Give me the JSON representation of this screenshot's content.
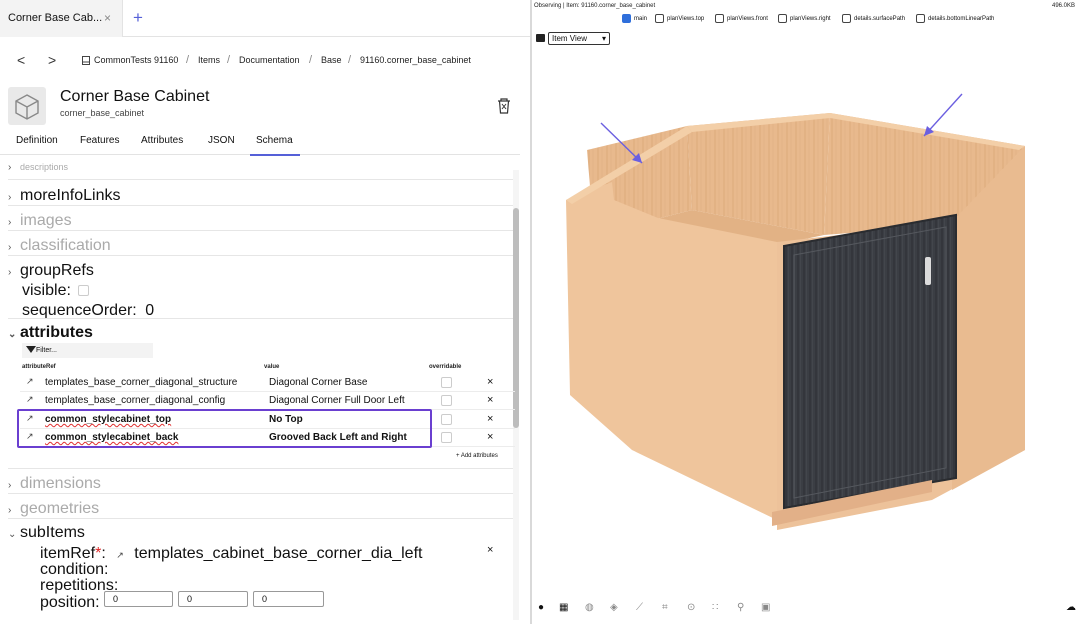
{
  "tab": {
    "title": "Corner Base Cab...",
    "close": "×",
    "add": "+"
  },
  "nav": {
    "back": "<",
    "forward": ">"
  },
  "breadcrumb": [
    "CommonTests 91160",
    "Items",
    "Documentation",
    "Base",
    "91160.corner_base_cabinet"
  ],
  "breadcrumb_sep": "/",
  "item": {
    "title": "Corner Base Cabinet",
    "id": "corner_base_cabinet"
  },
  "detail_tabs": [
    "Definition",
    "Features",
    "Attributes",
    "JSON",
    "Schema"
  ],
  "active_tab": "Schema",
  "tree": {
    "descriptions": "descriptions",
    "moreInfoLinks": "moreInfoLinks",
    "images": "images",
    "classification": "classification",
    "groupRefs": "groupRefs",
    "visible": "visible:",
    "sequenceOrder_label": "sequenceOrder:",
    "sequenceOrder_value": "0",
    "attributes": "attributes",
    "dimensions": "dimensions",
    "geometries": "geometries",
    "subItems": "subItems"
  },
  "filter_placeholder": "Filter...",
  "attr_columns": {
    "ref": "attributeRef",
    "value": "value",
    "overridable": "overridable"
  },
  "attributes": [
    {
      "ref": "templates_base_corner_diagonal_structure",
      "value": "Diagonal Corner Base",
      "bold": false
    },
    {
      "ref": "templates_base_corner_diagonal_config",
      "value": "Diagonal Corner Full Door Left",
      "bold": false
    },
    {
      "ref": "common_stylecabinet_top",
      "value": "No Top",
      "bold": true
    },
    {
      "ref": "common_stylecabinet_back",
      "value": "Grooved Back Left and Right",
      "bold": true
    }
  ],
  "remove_symbol": "×",
  "add_attributes": "+ Add attributes",
  "subitem": {
    "itemRef_label": "itemRef",
    "required_mark": "*",
    "itemRef_value": "templates_cabinet_base_corner_dia_left",
    "condition_label": "condition:",
    "repetitions_label": "repetitions:",
    "position_label": "position:",
    "position_values": [
      "0",
      "0",
      "0"
    ]
  },
  "viewer": {
    "status": "Observing | Item: 91160.corner_base_cabinet",
    "size": "496.0KB",
    "layers": [
      {
        "label": "main",
        "checked": true
      },
      {
        "label": "planViews.top",
        "checked": false
      },
      {
        "label": "planViews.front",
        "checked": false
      },
      {
        "label": "planViews.right",
        "checked": false
      },
      {
        "label": "details.surfacePath",
        "checked": false
      },
      {
        "label": "details.bottomLinearPath",
        "checked": false
      }
    ],
    "view_select": "Item View"
  },
  "colors": {
    "accent": "#5560d8",
    "highlight": "#6a3fd0",
    "arrow": "#6b5fe0",
    "wood": "#edc29a",
    "door": "#3b3e44"
  }
}
